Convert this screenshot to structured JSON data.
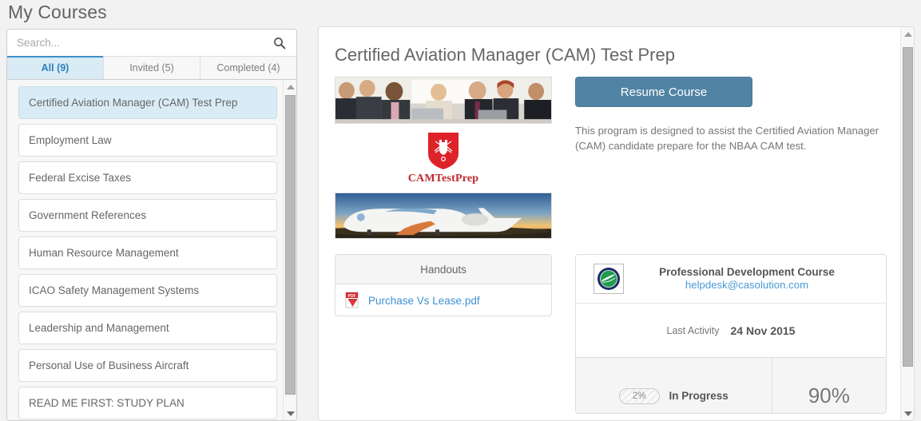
{
  "page": {
    "title": "My Courses"
  },
  "search": {
    "placeholder": "Search...",
    "value": "",
    "icon": "search-icon"
  },
  "tabs": [
    {
      "label": "All (9)",
      "active": true
    },
    {
      "label": "Invited (5)",
      "active": false
    },
    {
      "label": "Completed (4)",
      "active": false
    }
  ],
  "courses": [
    {
      "label": "Certified Aviation Manager (CAM) Test Prep",
      "selected": true
    },
    {
      "label": "Employment Law",
      "selected": false
    },
    {
      "label": "Federal Excise Taxes",
      "selected": false
    },
    {
      "label": "Government References",
      "selected": false
    },
    {
      "label": "Human Resource Management",
      "selected": false
    },
    {
      "label": "ICAO Safety Management Systems",
      "selected": false
    },
    {
      "label": "Leadership and Management",
      "selected": false
    },
    {
      "label": "Personal Use of Business Aircraft",
      "selected": false
    },
    {
      "label": "READ ME FIRST: STUDY PLAN",
      "selected": false
    }
  ],
  "detail": {
    "title": "Certified Aviation Manager (CAM) Test Prep",
    "resume_label": "Resume Course",
    "description": "This program is designed to assist the Certified Aviation Manager (CAM) candidate prepare for the NBAA CAM test.",
    "logo_text": "CAMTestPrep"
  },
  "handouts": {
    "header": "Handouts",
    "files": [
      {
        "name": "Purchase Vs Lease.pdf",
        "icon": "pdf-icon"
      }
    ]
  },
  "info": {
    "org_name": "Professional Development Course",
    "org_email": "helpdesk@casolution.com",
    "activity_label": "Last Activity",
    "activity_date": "24 Nov 2015",
    "progress_badge": "2%",
    "status": "In Progress",
    "score": "90%"
  },
  "colors": {
    "accent_blue": "#3b8fc9",
    "button_blue": "#5183a4",
    "link_blue": "#3f92d2",
    "selected_bg": "#d9ecf5",
    "pdf_red": "#c0282d"
  }
}
